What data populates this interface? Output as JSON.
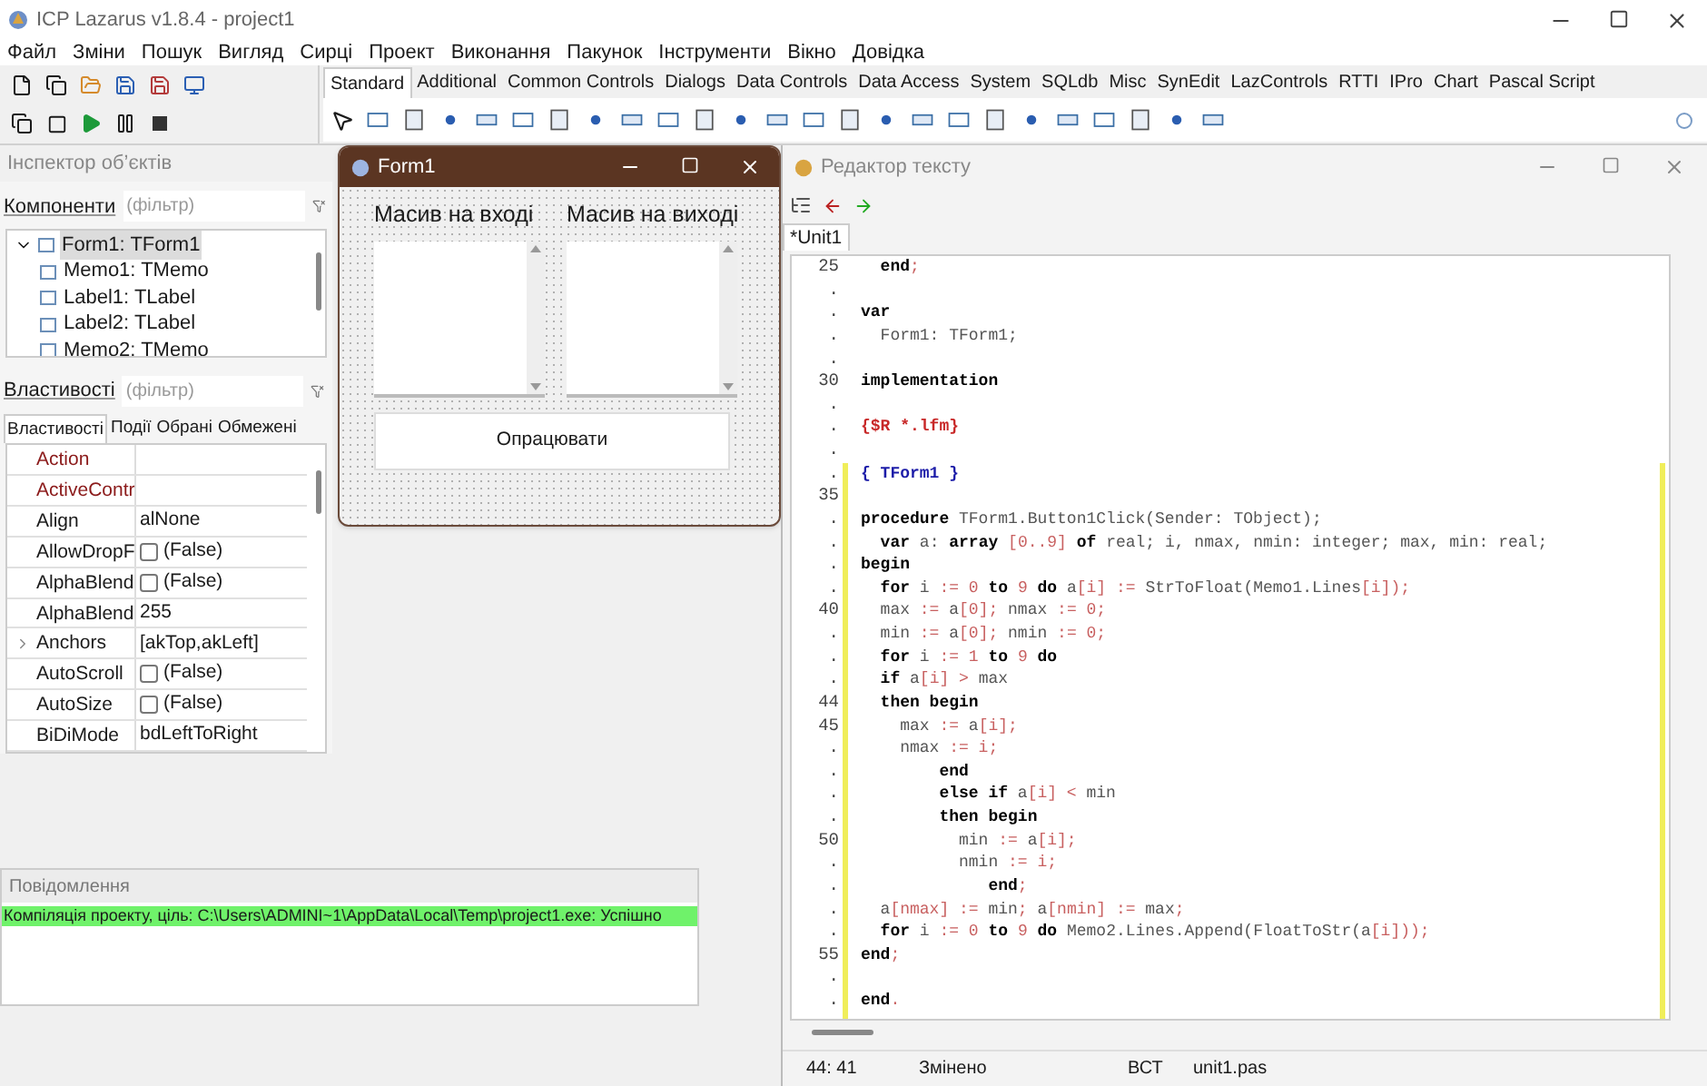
{
  "window": {
    "title": "ICP Lazarus v1.8.4 - project1"
  },
  "menu": [
    "Файл",
    "Зміни",
    "Пошук",
    "Вигляд",
    "Сирці",
    "Проект",
    "Виконання",
    "Пакунок",
    "Інструменти",
    "Вікно",
    "Довідка"
  ],
  "palette_tabs": [
    {
      "label": "Standard",
      "selected": true
    },
    {
      "label": "Additional",
      "selected": false
    },
    {
      "label": "Common Controls",
      "selected": false
    },
    {
      "label": "Dialogs",
      "selected": false
    },
    {
      "label": "Data Controls",
      "selected": false
    },
    {
      "label": "Data Access",
      "selected": false
    },
    {
      "label": "System",
      "selected": false
    },
    {
      "label": "SQLdb",
      "selected": false
    },
    {
      "label": "Misc",
      "selected": false
    },
    {
      "label": "SynEdit",
      "selected": false
    },
    {
      "label": "LazControls",
      "selected": false
    },
    {
      "label": "RTTI",
      "selected": false
    },
    {
      "label": "IPro",
      "selected": false
    },
    {
      "label": "Chart",
      "selected": false
    },
    {
      "label": "Pascal Script",
      "selected": false
    }
  ],
  "inspector": {
    "title": "Інспектор об’єктів",
    "components_label": "Компоненти",
    "components_filter": {
      "placeholder": "(фільтр)"
    },
    "tree": [
      {
        "label": "Form1: TForm1",
        "selected": true,
        "expanded": true,
        "children": [
          {
            "label": "Memo1: TMemo",
            "selected": false
          },
          {
            "label": "Label1: TLabel",
            "selected": false
          },
          {
            "label": "Label2: TLabel",
            "selected": false
          },
          {
            "label": "Memo2: TMemo",
            "selected": false
          }
        ]
      }
    ],
    "properties_label": "Властивості",
    "properties_filter": {
      "placeholder": "(фільтр)"
    },
    "tabs": [
      {
        "label": "Властивості",
        "selected": true
      },
      {
        "label": "Події",
        "selected": false
      },
      {
        "label": "Обрані",
        "selected": false
      },
      {
        "label": "Обмежені",
        "selected": false
      }
    ],
    "properties": [
      {
        "name": "Action",
        "reference": true,
        "kind": "text"
      },
      {
        "name": "ActiveContr",
        "reference": true,
        "kind": "text"
      },
      {
        "name": "Align",
        "reference": false,
        "kind": "text",
        "value": "alNone"
      },
      {
        "name": "AllowDropF",
        "reference": false,
        "kind": "check",
        "checked": false,
        "value": "(False)"
      },
      {
        "name": "AlphaBlend",
        "reference": false,
        "kind": "check",
        "checked": false,
        "value": "(False)"
      },
      {
        "name": "AlphaBlend",
        "reference": false,
        "kind": "text",
        "value": "255"
      },
      {
        "name": "Anchors",
        "reference": false,
        "kind": "text",
        "expander": true,
        "value": "[akTop,akLeft]"
      },
      {
        "name": "AutoScroll",
        "reference": false,
        "kind": "check",
        "checked": false,
        "value": "(False)"
      },
      {
        "name": "AutoSize",
        "reference": false,
        "kind": "check",
        "checked": false,
        "value": "(False)"
      },
      {
        "name": "BiDiMode",
        "reference": false,
        "kind": "text",
        "value": "bdLeftToRight"
      }
    ]
  },
  "messages": {
    "title": "Повідомлення",
    "lines": [
      {
        "text": "Компіляція проекту, ціль: C:\\Users\\ADMINI~1\\AppData\\Local\\Temp\\project1.exe: Успішно",
        "kind": "success"
      }
    ]
  },
  "form": {
    "title": "Form1",
    "label_1": "Масив на вході",
    "label_2": "Масив на виході",
    "button": "Опрацювати"
  },
  "editor": {
    "title": "Редактор тексту",
    "tabs": [
      {
        "label": "*Unit1",
        "selected": true
      }
    ],
    "lines": [
      {
        "gutter": "25",
        "tokens": [
          {
            "kind": "k",
            "text": "  end"
          },
          {
            "kind": "s",
            "text": ";"
          }
        ]
      },
      {
        "gutter": "."
      },
      {
        "gutter": ".",
        "tokens": [
          {
            "kind": "k",
            "text": "var"
          }
        ]
      },
      {
        "gutter": ".",
        "tokens": [
          {
            "kind": "t",
            "text": "  Form1: TForm1;"
          }
        ]
      },
      {
        "gutter": "."
      },
      {
        "gutter": "30",
        "tokens": [
          {
            "kind": "k",
            "text": "implementation"
          }
        ]
      },
      {
        "gutter": "."
      },
      {
        "gutter": ".",
        "tokens": [
          {
            "kind": "d",
            "text": "{$R *.lfm}"
          }
        ]
      },
      {
        "gutter": "."
      },
      {
        "gutter": ".",
        "tokens": [
          {
            "kind": "c",
            "text": "{ TForm1 }"
          }
        ]
      },
      {
        "gutter": "35"
      },
      {
        "gutter": ".",
        "tokens": [
          {
            "kind": "k",
            "text": "procedure"
          },
          {
            "kind": "t",
            "text": " TForm1.Button1Click(Sender: TObject);"
          }
        ]
      },
      {
        "gutter": ".",
        "tokens": [
          {
            "kind": "k",
            "text": "  var"
          },
          {
            "kind": "t",
            "text": " a: "
          },
          {
            "kind": "k",
            "text": "array"
          },
          {
            "kind": "s",
            "text": " [0..9] "
          },
          {
            "kind": "k",
            "text": "of"
          },
          {
            "kind": "t",
            "text": " real; i, nmax, nmin: integer; max, min: real;"
          }
        ]
      },
      {
        "gutter": ".",
        "tokens": [
          {
            "kind": "k",
            "text": "begin"
          }
        ]
      },
      {
        "gutter": ".",
        "tokens": [
          {
            "kind": "k",
            "text": "  for"
          },
          {
            "kind": "t",
            "text": " i "
          },
          {
            "kind": "s",
            "text": ":= 0 "
          },
          {
            "kind": "k",
            "text": "to"
          },
          {
            "kind": "s",
            "text": " 9 "
          },
          {
            "kind": "k",
            "text": "do"
          },
          {
            "kind": "t",
            "text": " a"
          },
          {
            "kind": "s",
            "text": "[i] := "
          },
          {
            "kind": "t",
            "text": "StrToFloat(Memo1.Lines"
          },
          {
            "kind": "s",
            "text": "[i]);"
          }
        ]
      },
      {
        "gutter": "40",
        "tokens": [
          {
            "kind": "t",
            "text": "  max "
          },
          {
            "kind": "s",
            "text": ":= "
          },
          {
            "kind": "t",
            "text": "a"
          },
          {
            "kind": "s",
            "text": "[0]; "
          },
          {
            "kind": "t",
            "text": "nmax "
          },
          {
            "kind": "s",
            "text": ":= 0;"
          }
        ]
      },
      {
        "gutter": ".",
        "tokens": [
          {
            "kind": "t",
            "text": "  min "
          },
          {
            "kind": "s",
            "text": ":= "
          },
          {
            "kind": "t",
            "text": "a"
          },
          {
            "kind": "s",
            "text": "[0]; "
          },
          {
            "kind": "t",
            "text": "nmin "
          },
          {
            "kind": "s",
            "text": ":= 0;"
          }
        ]
      },
      {
        "gutter": ".",
        "tokens": [
          {
            "kind": "k",
            "text": "  for"
          },
          {
            "kind": "t",
            "text": " i "
          },
          {
            "kind": "s",
            "text": ":= 1 "
          },
          {
            "kind": "k",
            "text": "to"
          },
          {
            "kind": "s",
            "text": " 9 "
          },
          {
            "kind": "k",
            "text": "do"
          }
        ]
      },
      {
        "gutter": ".",
        "tokens": [
          {
            "kind": "k",
            "text": "  if"
          },
          {
            "kind": "t",
            "text": " a"
          },
          {
            "kind": "s",
            "text": "[i] > "
          },
          {
            "kind": "t",
            "text": "max"
          }
        ]
      },
      {
        "gutter": "44",
        "tokens": [
          {
            "kind": "k",
            "text": "  then begin"
          }
        ]
      },
      {
        "gutter": "45",
        "tokens": [
          {
            "kind": "t",
            "text": "    max "
          },
          {
            "kind": "s",
            "text": ":= "
          },
          {
            "kind": "t",
            "text": "a"
          },
          {
            "kind": "s",
            "text": "[i];"
          }
        ]
      },
      {
        "gutter": ".",
        "tokens": [
          {
            "kind": "t",
            "text": "    nmax "
          },
          {
            "kind": "s",
            "text": ":= i;"
          }
        ]
      },
      {
        "gutter": ".",
        "tokens": [
          {
            "kind": "k",
            "text": "        end"
          }
        ]
      },
      {
        "gutter": ".",
        "tokens": [
          {
            "kind": "k",
            "text": "        else if"
          },
          {
            "kind": "t",
            "text": " a"
          },
          {
            "kind": "s",
            "text": "[i] < "
          },
          {
            "kind": "t",
            "text": "min"
          }
        ]
      },
      {
        "gutter": ".",
        "tokens": [
          {
            "kind": "k",
            "text": "        then begin"
          }
        ]
      },
      {
        "gutter": "50",
        "tokens": [
          {
            "kind": "t",
            "text": "          min "
          },
          {
            "kind": "s",
            "text": ":= "
          },
          {
            "kind": "t",
            "text": "a"
          },
          {
            "kind": "s",
            "text": "[i];"
          }
        ]
      },
      {
        "gutter": ".",
        "tokens": [
          {
            "kind": "t",
            "text": "          nmin "
          },
          {
            "kind": "s",
            "text": ":= i;"
          }
        ]
      },
      {
        "gutter": ".",
        "tokens": [
          {
            "kind": "k",
            "text": "             end"
          },
          {
            "kind": "s",
            "text": ";"
          }
        ]
      },
      {
        "gutter": ".",
        "tokens": [
          {
            "kind": "t",
            "text": "  a"
          },
          {
            "kind": "s",
            "text": "[nmax] := "
          },
          {
            "kind": "t",
            "text": "min"
          },
          {
            "kind": "s",
            "text": "; "
          },
          {
            "kind": "t",
            "text": "a"
          },
          {
            "kind": "s",
            "text": "[nmin] := "
          },
          {
            "kind": "t",
            "text": "max"
          },
          {
            "kind": "s",
            "text": ";"
          }
        ]
      },
      {
        "gutter": ".",
        "tokens": [
          {
            "kind": "k",
            "text": "  for"
          },
          {
            "kind": "t",
            "text": " i "
          },
          {
            "kind": "s",
            "text": ":= 0 "
          },
          {
            "kind": "k",
            "text": "to"
          },
          {
            "kind": "s",
            "text": " 9 "
          },
          {
            "kind": "k",
            "text": "do"
          },
          {
            "kind": "t",
            "text": " Memo2.Lines.Append(FloatToStr(a"
          },
          {
            "kind": "s",
            "text": "[i]));"
          }
        ]
      },
      {
        "gutter": "55",
        "tokens": [
          {
            "kind": "k",
            "text": "end"
          },
          {
            "kind": "s",
            "text": ";"
          }
        ]
      },
      {
        "gutter": "."
      },
      {
        "gutter": ".",
        "tokens": [
          {
            "kind": "k",
            "text": "end"
          },
          {
            "kind": "s",
            "text": "."
          }
        ]
      }
    ],
    "status": {
      "position": "44: 41",
      "state": "Змінено",
      "mode": "ВСТ",
      "file": "unit1.pas"
    }
  }
}
